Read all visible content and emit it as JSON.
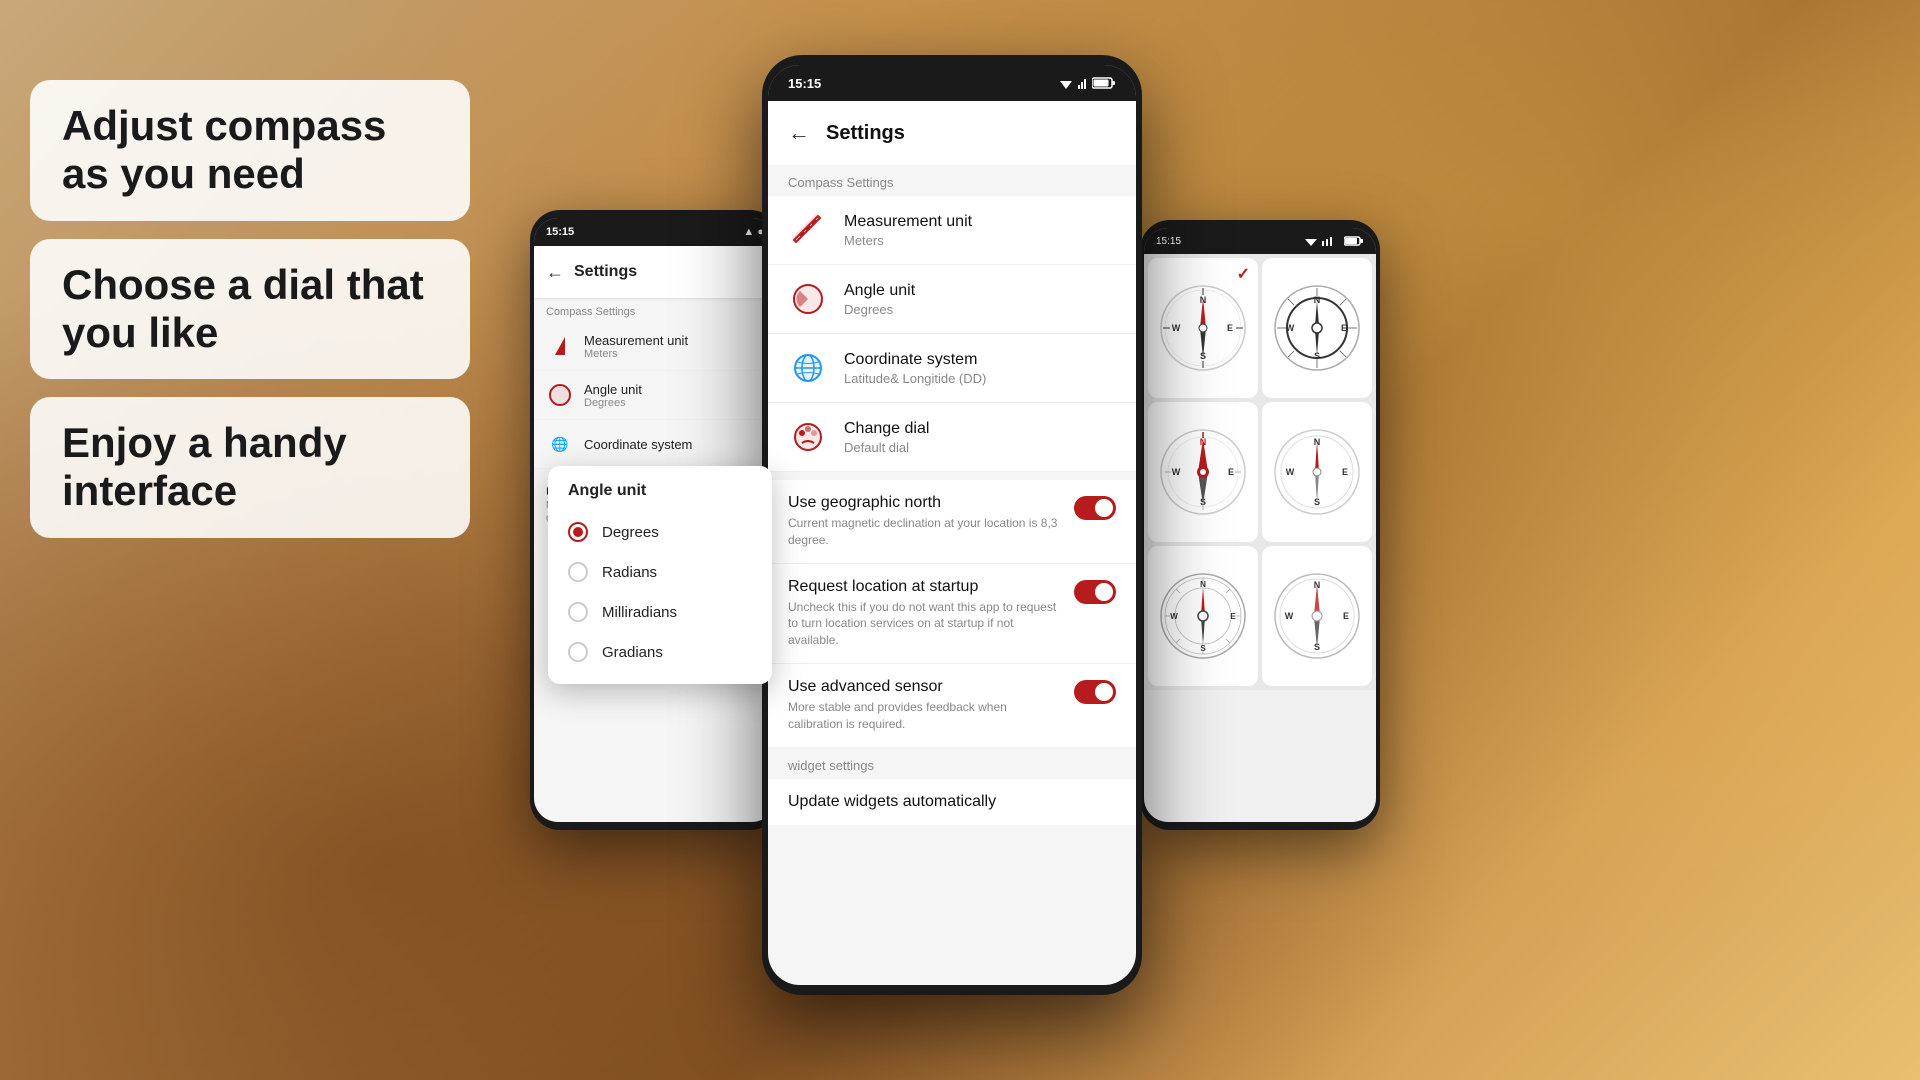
{
  "background": {
    "gradient": "desert sunset"
  },
  "left_cards": [
    {
      "id": "card-1",
      "text": "Adjust compass\nas you need"
    },
    {
      "id": "card-2",
      "text": "Choose a dial\nthat you like"
    },
    {
      "id": "card-3",
      "text": "Enjoy a handy\ninterface"
    }
  ],
  "phone_bg": {
    "status_time": "15:15",
    "app_title": "Settings",
    "section_label": "Compass Settings",
    "settings": [
      {
        "label": "Measurement unit",
        "value": "Meters"
      },
      {
        "label": "Angle unit",
        "value": "Degrees"
      },
      {
        "label": "Coordinate system",
        "value": ""
      }
    ],
    "toggle_rows": [
      {
        "title": "Use advanced sensor",
        "desc": "More stable and provides feedback w... calibration is required"
      }
    ]
  },
  "angle_popup": {
    "title": "Angle unit",
    "options": [
      {
        "label": "Degrees",
        "selected": true
      },
      {
        "label": "Radians",
        "selected": false
      },
      {
        "label": "Milliradians",
        "selected": false
      },
      {
        "label": "Gradians",
        "selected": false
      }
    ]
  },
  "phone_main": {
    "status_time": "15:15",
    "app_title": "Settings",
    "section_label": "Compass Settings",
    "settings": [
      {
        "label": "Measurement unit",
        "value": "Meters",
        "icon": "ruler"
      },
      {
        "label": "Angle unit",
        "value": "Degrees",
        "icon": "angle"
      },
      {
        "label": "Coordinate system",
        "value": "Latitude& Longitide (DD)",
        "icon": "globe"
      },
      {
        "label": "Change dial",
        "value": "Default dial",
        "icon": "palette"
      }
    ],
    "toggles": [
      {
        "title": "Use geographic north",
        "desc": "Current magnetic declination at your location is 8,3 degree.",
        "on": true
      },
      {
        "title": "Request location at startup",
        "desc": "Uncheck this if you do not want this app to request to turn location services on at startup if not available.",
        "on": true
      },
      {
        "title": "Use advanced sensor",
        "desc": "More stable and provides feedback when calibration is required.",
        "on": true
      }
    ],
    "widget_section": "widget settings",
    "widget_item": "Update widgets automatically"
  },
  "phone_right": {
    "status_time": "15:15",
    "dials": [
      {
        "id": "dial-1",
        "type": "classic",
        "selected": true
      },
      {
        "id": "dial-2",
        "type": "military",
        "selected": false
      },
      {
        "id": "dial-3",
        "type": "modern-red",
        "selected": false
      },
      {
        "id": "dial-4",
        "type": "minimal",
        "selected": false
      },
      {
        "id": "dial-5",
        "type": "tactical",
        "selected": false
      },
      {
        "id": "dial-6",
        "type": "vintage",
        "selected": false
      }
    ]
  }
}
